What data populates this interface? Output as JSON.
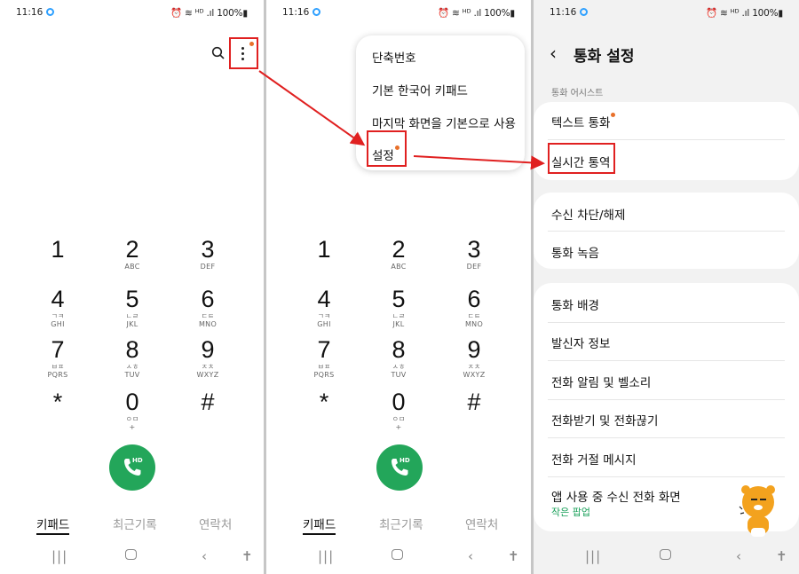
{
  "status_bar": {
    "time": "11:16",
    "indicators": "⏰ ≋ ᴴᴰ .ıl 100%▮"
  },
  "dialer": {
    "keys": [
      {
        "digit": "1",
        "korean": "",
        "letters": ""
      },
      {
        "digit": "2",
        "korean": "",
        "letters": "ABC"
      },
      {
        "digit": "3",
        "korean": "",
        "letters": "DEF"
      },
      {
        "digit": "4",
        "korean": "ㄱㅋ",
        "letters": "GHI"
      },
      {
        "digit": "5",
        "korean": "ㄴㄹ",
        "letters": "JKL"
      },
      {
        "digit": "6",
        "korean": "ㄷㅌ",
        "letters": "MNO"
      },
      {
        "digit": "7",
        "korean": "ㅂㅍ",
        "letters": "PQRS"
      },
      {
        "digit": "8",
        "korean": "ㅅㅎ",
        "letters": "TUV"
      },
      {
        "digit": "9",
        "korean": "ㅈㅊ",
        "letters": "WXYZ"
      },
      {
        "digit": "*",
        "korean": "",
        "letters": ""
      },
      {
        "digit": "0",
        "korean": "ㅇㅁ",
        "letters": "+"
      },
      {
        "digit": "#",
        "korean": "",
        "letters": ""
      }
    ],
    "call_badge": "HD",
    "tabs": [
      "키패드",
      "최근기록",
      "연락처"
    ]
  },
  "overflow_menu": {
    "items": [
      "단축번호",
      "기본 한국어 키패드",
      "마지막 화면을 기본으로 사용",
      "설정"
    ]
  },
  "settings": {
    "title": "통화 설정",
    "section_label": "통화 어시스트",
    "group1": [
      "텍스트 통화",
      "실시간 통역"
    ],
    "group2": [
      "수신 차단/해제",
      "통화 녹음"
    ],
    "group3": [
      "통화 배경",
      "발신자 정보",
      "전화 알림 및 벨소리",
      "전화받기 및 전화끊기",
      "전화 거절 메시지",
      "앱 사용 중 수신 전화 화면"
    ],
    "group3_sub": "작은 팝업"
  },
  "colors": {
    "call_button": "#23a65a",
    "highlight_box": "#e02020",
    "badge_dot": "#e8702a",
    "subtitle_green": "#1aa05a"
  },
  "icons": [
    "search-icon",
    "more-vert-icon",
    "phone-icon",
    "back-icon",
    "recents-nav-icon",
    "home-nav-icon",
    "back-nav-icon",
    "accessibility-icon"
  ]
}
